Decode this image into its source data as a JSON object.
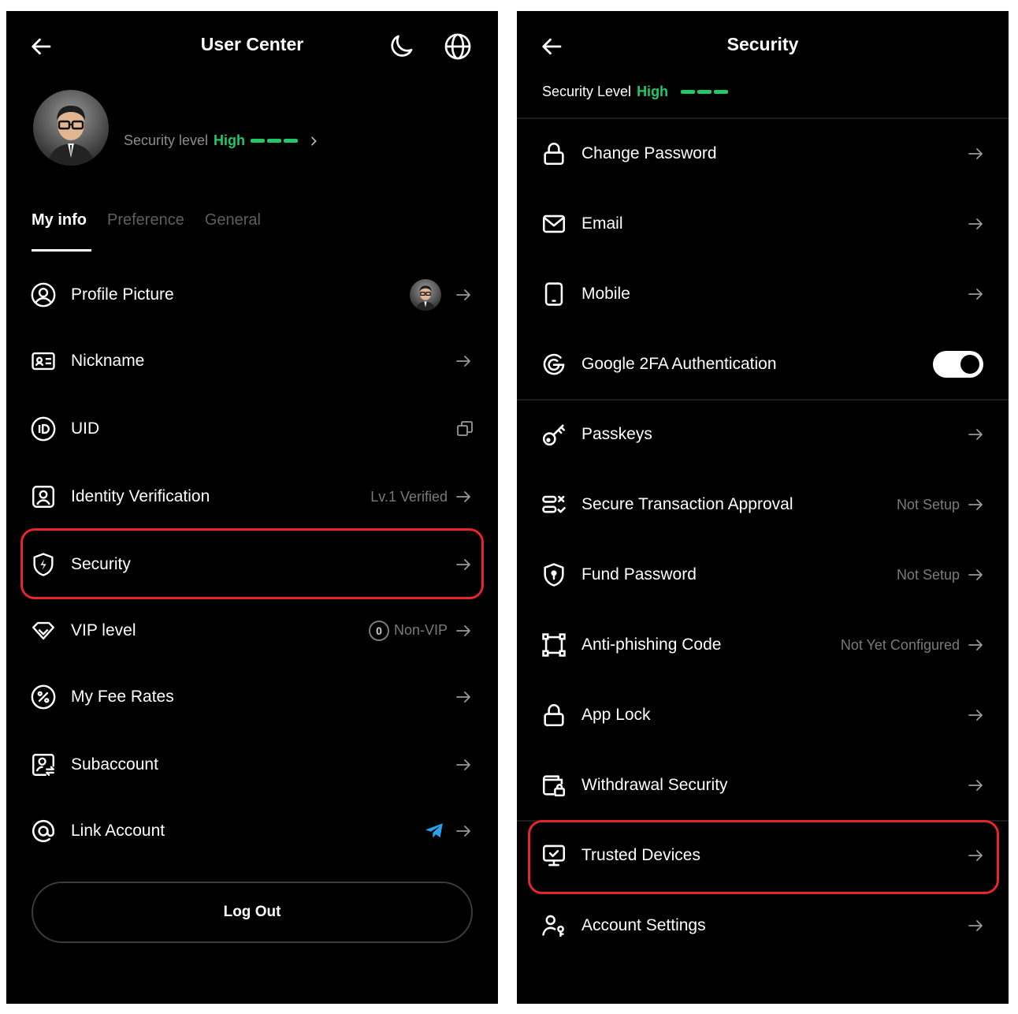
{
  "left": {
    "title": "User Center",
    "security_prefix": "Security level",
    "security_value": "High",
    "tabs": [
      "My info",
      "Preference",
      "General"
    ],
    "items": [
      {
        "label": "Profile Picture",
        "icon": "user-circle-icon",
        "value": ""
      },
      {
        "label": "Nickname",
        "icon": "id-card-icon",
        "value": ""
      },
      {
        "label": "UID",
        "icon": "id-badge-icon",
        "value": ""
      },
      {
        "label": "Identity Verification",
        "icon": "identity-icon",
        "value": "Lv.1 Verified"
      },
      {
        "label": "Security",
        "icon": "shield-bolt-icon",
        "value": ""
      },
      {
        "label": "VIP level",
        "icon": "diamond-icon",
        "value": "Non-VIP",
        "badge": "0"
      },
      {
        "label": "My Fee Rates",
        "icon": "percent-icon",
        "value": ""
      },
      {
        "label": "Subaccount",
        "icon": "subaccount-icon",
        "value": ""
      },
      {
        "label": "Link Account",
        "icon": "at-icon",
        "value": ""
      }
    ],
    "logout_label": "Log Out"
  },
  "right": {
    "title": "Security",
    "security_prefix": "Security Level",
    "security_value": "High",
    "items": [
      {
        "label": "Change Password",
        "icon": "lock-icon",
        "value": ""
      },
      {
        "label": "Email",
        "icon": "mail-icon",
        "value": ""
      },
      {
        "label": "Mobile",
        "icon": "phone-icon",
        "value": ""
      },
      {
        "label": "Google 2FA Authentication",
        "icon": "google-icon",
        "value": "",
        "toggle_on": true
      },
      {
        "label": "Passkeys",
        "icon": "key-icon",
        "value": ""
      },
      {
        "label": "Secure Transaction Approval",
        "icon": "approval-icon",
        "value": "Not Setup"
      },
      {
        "label": "Fund Password",
        "icon": "shield-lock-icon",
        "value": "Not Setup"
      },
      {
        "label": "Anti-phishing Code",
        "icon": "frame-icon",
        "value": "Not Yet Configured"
      },
      {
        "label": "App Lock",
        "icon": "lock-icon",
        "value": ""
      },
      {
        "label": "Withdrawal Security",
        "icon": "wallet-lock-icon",
        "value": ""
      },
      {
        "label": "Trusted Devices",
        "icon": "monitor-check-icon",
        "value": ""
      },
      {
        "label": "Account Settings",
        "icon": "user-settings-icon",
        "value": ""
      }
    ]
  },
  "colors": {
    "accent_green": "#20c86a",
    "highlight_red": "#e5262b",
    "telegram_blue": "#2aa3ef"
  }
}
